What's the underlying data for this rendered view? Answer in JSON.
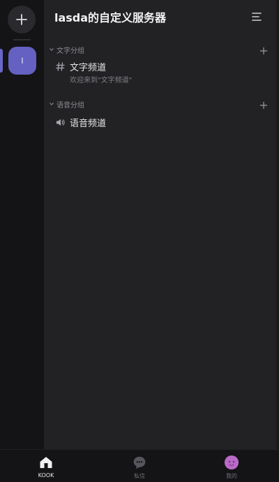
{
  "server": {
    "name": "lasda的自定义服务器",
    "icon_initial": "l"
  },
  "categories": [
    {
      "label": "文字分组",
      "channels": [
        {
          "name": "文字频道",
          "topic": "欢迎来到\"文字频道\"",
          "icon": "hash-icon"
        }
      ]
    },
    {
      "label": "语音分组",
      "channels": [
        {
          "name": "语音频道",
          "icon": "speaker-icon"
        }
      ]
    }
  ],
  "bottom_nav": {
    "items": [
      {
        "label": "KOOK",
        "icon": "home-icon",
        "active": true
      },
      {
        "label": "私信",
        "icon": "chat-bubble-icon",
        "active": false
      },
      {
        "label": "我的",
        "icon": "avatar",
        "active": false
      }
    ]
  },
  "colors": {
    "accent": "#6561c2",
    "background": "#222225",
    "rail": "#141416"
  }
}
